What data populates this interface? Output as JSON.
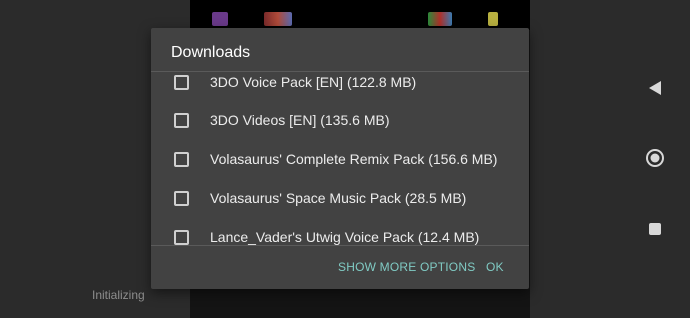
{
  "dialog": {
    "title": "Downloads",
    "items": [
      {
        "label": "3DO Voice Pack [EN] (122.8 MB)",
        "checked": false
      },
      {
        "label": "3DO Videos [EN] (135.6 MB)",
        "checked": false
      },
      {
        "label": "Volasaurus' Complete Remix Pack (156.6 MB)",
        "checked": false
      },
      {
        "label": "Volasaurus' Space Music Pack (28.5 MB)",
        "checked": false
      },
      {
        "label": "Lance_Vader's Utwig Voice Pack (12.4 MB)",
        "checked": false
      }
    ],
    "show_more_label": "SHOW MORE OPTIONS",
    "ok_label": "OK"
  },
  "status": {
    "text": "Initializing"
  },
  "navbar": {
    "back_icon": "back-triangle-icon",
    "home_icon": "home-circle-icon",
    "recents_icon": "recents-square-icon"
  },
  "colors": {
    "accent": "#80cbc4",
    "dialog_bg": "#424242",
    "background": "#2b2b2b"
  }
}
